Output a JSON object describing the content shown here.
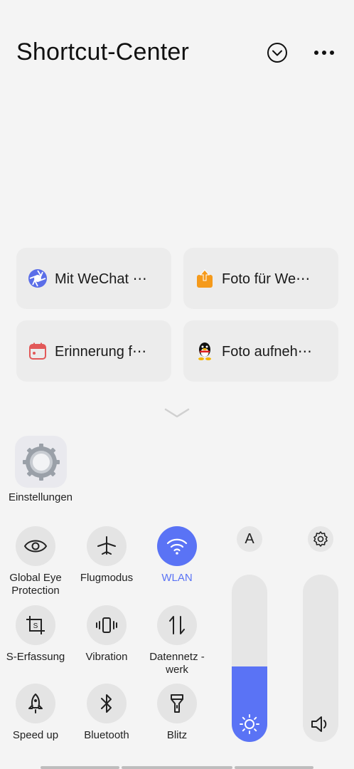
{
  "header": {
    "title": "Shortcut-Center"
  },
  "shortcuts": [
    {
      "label": "Mit WeChat ⋯",
      "icon": "wechat-scan-icon"
    },
    {
      "label": "Foto für We⋯",
      "icon": "share-upload-icon"
    },
    {
      "label": "Erinnerung f⋯",
      "icon": "calendar-icon"
    },
    {
      "label": "Foto aufneh⋯",
      "icon": "qq-penguin-icon"
    }
  ],
  "apps": [
    {
      "label": "Einstellungen",
      "icon": "settings-gear-icon"
    }
  ],
  "toggles": [
    {
      "label": "Global Eye Protection",
      "icon": "eye-icon",
      "on": false
    },
    {
      "label": "Flugmodus",
      "icon": "airplane-icon",
      "on": false
    },
    {
      "label": "WLAN",
      "icon": "wifi-icon",
      "on": true
    },
    {
      "label": "S-Erfassung",
      "icon": "screenshot-crop-icon",
      "on": false
    },
    {
      "label": "Vibration",
      "icon": "vibration-icon",
      "on": false
    },
    {
      "label": "Datennetz - werk",
      "icon": "mobile-data-icon",
      "on": false
    },
    {
      "label": "Speed up",
      "icon": "rocket-icon",
      "on": false
    },
    {
      "label": "Bluetooth",
      "icon": "bluetooth-icon",
      "on": false
    },
    {
      "label": "Blitz",
      "icon": "flashlight-icon",
      "on": false
    }
  ],
  "brightness": {
    "level": 0.45,
    "auto_label": "A"
  },
  "volume": {
    "level": 0.0
  },
  "colors": {
    "accent": "#5a73f5",
    "tile": "#e4e4e4",
    "background": "#f4f4f4"
  }
}
